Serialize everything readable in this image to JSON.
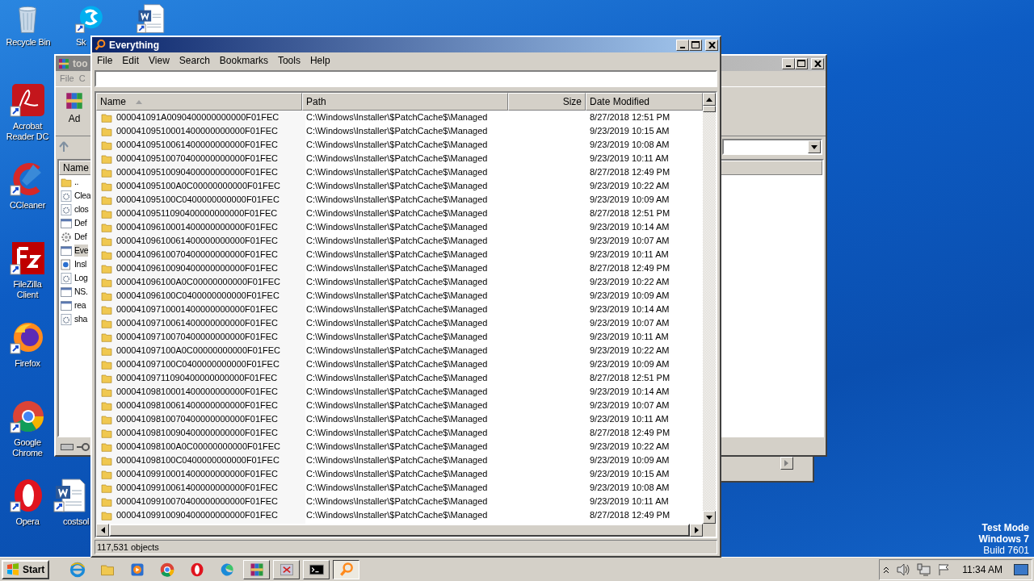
{
  "desktop_icons": [
    {
      "kind": "recycle",
      "label": "Recycle Bin"
    },
    {
      "kind": "skype",
      "label": "Sk"
    },
    {
      "kind": "word"
    },
    {
      "kind": "acrobat",
      "label": "Acrobat Reader DC"
    },
    {
      "kind": "ccleaner",
      "label": "CCleaner"
    },
    {
      "kind": "filezilla",
      "label": "FileZilla Client"
    },
    {
      "kind": "firefox",
      "label": "Firefox"
    },
    {
      "kind": "chrome",
      "label": "Google Chrome"
    },
    {
      "kind": "opera",
      "label": "Opera"
    },
    {
      "kind": "word",
      "label": "costsol"
    }
  ],
  "background_window": {
    "title": "too",
    "menu": [
      "File",
      "C"
    ],
    "toolbar_label": "Ad",
    "column": "Name",
    "files": [
      {
        "kind": "parent",
        "name": "..",
        "selected": false
      },
      {
        "kind": "script",
        "name": "Clea",
        "selected": false
      },
      {
        "kind": "script",
        "name": "clos",
        "selected": false
      },
      {
        "kind": "window",
        "name": "Def",
        "selected": false
      },
      {
        "kind": "settings",
        "name": "Def",
        "selected": false
      },
      {
        "kind": "window",
        "name": "Eve",
        "selected": true
      },
      {
        "kind": "installer",
        "name": "Insl",
        "selected": false
      },
      {
        "kind": "script",
        "name": "Log",
        "selected": false
      },
      {
        "kind": "window",
        "name": "NS.",
        "selected": false
      },
      {
        "kind": "window",
        "name": "rea",
        "selected": false
      },
      {
        "kind": "script",
        "name": "sha",
        "selected": false
      }
    ]
  },
  "window": {
    "title": "Everything",
    "menu": [
      "File",
      "Edit",
      "View",
      "Search",
      "Bookmarks",
      "Tools",
      "Help"
    ],
    "columns": [
      {
        "label": "Name",
        "sorted": true
      },
      {
        "label": "Path",
        "sorted": false
      },
      {
        "label": "Size",
        "sorted": false
      },
      {
        "label": "Date Modified",
        "sorted": false
      }
    ],
    "rows": [
      {
        "name": "000041091A0090400000000000F01FEC",
        "path": "C:\\Windows\\Installer\\$PatchCache$\\Managed",
        "date": "8/27/2018 12:51 PM"
      },
      {
        "name": "00004109510001400000000000F01FEC",
        "path": "C:\\Windows\\Installer\\$PatchCache$\\Managed",
        "date": "9/23/2019 10:15 AM"
      },
      {
        "name": "00004109510061400000000000F01FEC",
        "path": "C:\\Windows\\Installer\\$PatchCache$\\Managed",
        "date": "9/23/2019 10:08 AM"
      },
      {
        "name": "00004109510070400000000000F01FEC",
        "path": "C:\\Windows\\Installer\\$PatchCache$\\Managed",
        "date": "9/23/2019 10:11 AM"
      },
      {
        "name": "00004109510090400000000000F01FEC",
        "path": "C:\\Windows\\Installer\\$PatchCache$\\Managed",
        "date": "8/27/2018 12:49 PM"
      },
      {
        "name": "000041095100A0C00000000000F01FEC",
        "path": "C:\\Windows\\Installer\\$PatchCache$\\Managed",
        "date": "9/23/2019 10:22 AM"
      },
      {
        "name": "000041095100C0400000000000F01FEC",
        "path": "C:\\Windows\\Installer\\$PatchCache$\\Managed",
        "date": "9/23/2019 10:09 AM"
      },
      {
        "name": "00004109511090400000000000F01FEC",
        "path": "C:\\Windows\\Installer\\$PatchCache$\\Managed",
        "date": "8/27/2018 12:51 PM"
      },
      {
        "name": "00004109610001400000000000F01FEC",
        "path": "C:\\Windows\\Installer\\$PatchCache$\\Managed",
        "date": "9/23/2019 10:14 AM"
      },
      {
        "name": "00004109610061400000000000F01FEC",
        "path": "C:\\Windows\\Installer\\$PatchCache$\\Managed",
        "date": "9/23/2019 10:07 AM"
      },
      {
        "name": "00004109610070400000000000F01FEC",
        "path": "C:\\Windows\\Installer\\$PatchCache$\\Managed",
        "date": "9/23/2019 10:11 AM"
      },
      {
        "name": "00004109610090400000000000F01FEC",
        "path": "C:\\Windows\\Installer\\$PatchCache$\\Managed",
        "date": "8/27/2018 12:49 PM"
      },
      {
        "name": "000041096100A0C00000000000F01FEC",
        "path": "C:\\Windows\\Installer\\$PatchCache$\\Managed",
        "date": "9/23/2019 10:22 AM"
      },
      {
        "name": "000041096100C0400000000000F01FEC",
        "path": "C:\\Windows\\Installer\\$PatchCache$\\Managed",
        "date": "9/23/2019 10:09 AM"
      },
      {
        "name": "00004109710001400000000000F01FEC",
        "path": "C:\\Windows\\Installer\\$PatchCache$\\Managed",
        "date": "9/23/2019 10:14 AM"
      },
      {
        "name": "00004109710061400000000000F01FEC",
        "path": "C:\\Windows\\Installer\\$PatchCache$\\Managed",
        "date": "9/23/2019 10:07 AM"
      },
      {
        "name": "00004109710070400000000000F01FEC",
        "path": "C:\\Windows\\Installer\\$PatchCache$\\Managed",
        "date": "9/23/2019 10:11 AM"
      },
      {
        "name": "000041097100A0C00000000000F01FEC",
        "path": "C:\\Windows\\Installer\\$PatchCache$\\Managed",
        "date": "9/23/2019 10:22 AM"
      },
      {
        "name": "000041097100C0400000000000F01FEC",
        "path": "C:\\Windows\\Installer\\$PatchCache$\\Managed",
        "date": "9/23/2019 10:09 AM"
      },
      {
        "name": "00004109711090400000000000F01FEC",
        "path": "C:\\Windows\\Installer\\$PatchCache$\\Managed",
        "date": "8/27/2018 12:51 PM"
      },
      {
        "name": "00004109810001400000000000F01FEC",
        "path": "C:\\Windows\\Installer\\$PatchCache$\\Managed",
        "date": "9/23/2019 10:14 AM"
      },
      {
        "name": "00004109810061400000000000F01FEC",
        "path": "C:\\Windows\\Installer\\$PatchCache$\\Managed",
        "date": "9/23/2019 10:07 AM"
      },
      {
        "name": "00004109810070400000000000F01FEC",
        "path": "C:\\Windows\\Installer\\$PatchCache$\\Managed",
        "date": "9/23/2019 10:11 AM"
      },
      {
        "name": "00004109810090400000000000F01FEC",
        "path": "C:\\Windows\\Installer\\$PatchCache$\\Managed",
        "date": "8/27/2018 12:49 PM"
      },
      {
        "name": "000041098100A0C00000000000F01FEC",
        "path": "C:\\Windows\\Installer\\$PatchCache$\\Managed",
        "date": "9/23/2019 10:22 AM"
      },
      {
        "name": "000041098100C0400000000000F01FEC",
        "path": "C:\\Windows\\Installer\\$PatchCache$\\Managed",
        "date": "9/23/2019 10:09 AM"
      },
      {
        "name": "00004109910001400000000000F01FEC",
        "path": "C:\\Windows\\Installer\\$PatchCache$\\Managed",
        "date": "9/23/2019 10:15 AM"
      },
      {
        "name": "00004109910061400000000000F01FEC",
        "path": "C:\\Windows\\Installer\\$PatchCache$\\Managed",
        "date": "9/23/2019 10:08 AM"
      },
      {
        "name": "00004109910070400000000000F01FEC",
        "path": "C:\\Windows\\Installer\\$PatchCache$\\Managed",
        "date": "9/23/2019 10:11 AM"
      },
      {
        "name": "00004109910090400000000000F01FEC",
        "path": "C:\\Windows\\Installer\\$PatchCache$\\Managed",
        "date": "8/27/2018 12:49 PM"
      }
    ],
    "status_bar": "117,531 objects"
  },
  "os_notice": [
    "Test Mode",
    "Windows 7",
    "Build 7601"
  ],
  "taskbar": {
    "start": "Start",
    "apps": [
      {
        "kind": "ie",
        "active": false
      },
      {
        "kind": "explorer",
        "active": false
      },
      {
        "kind": "media",
        "active": false
      },
      {
        "kind": "chrome",
        "active": false
      },
      {
        "kind": "opera",
        "active": false
      },
      {
        "kind": "edge",
        "active": false
      },
      {
        "kind": "winrar",
        "active": false
      },
      {
        "kind": "app",
        "active": false
      },
      {
        "kind": "cmd",
        "active": false
      },
      {
        "kind": "everything",
        "active": true
      }
    ],
    "clock": "11:34 AM"
  }
}
